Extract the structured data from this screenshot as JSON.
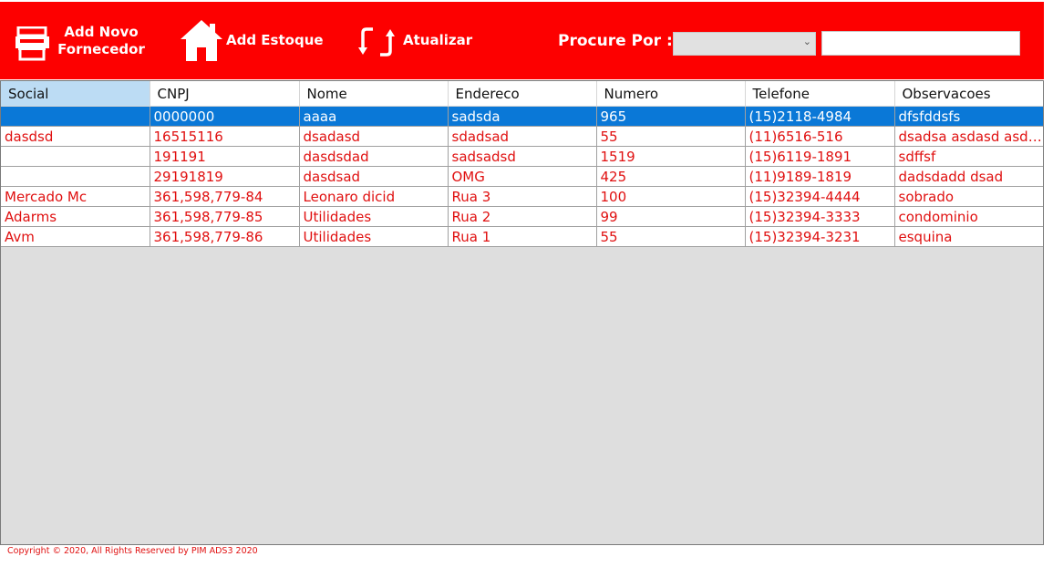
{
  "toolbar": {
    "add_fornecedor_line1": "Add Novo",
    "add_fornecedor_line2": "Fornecedor",
    "add_estoque_label": "Add Estoque",
    "atualizar_label": "Atualizar",
    "procure_label": "Procure Por :",
    "filter_select_value": "",
    "search_value": "",
    "icons": [
      "printer-icon",
      "home-icon",
      "refresh-icon"
    ]
  },
  "grid": {
    "columns": [
      "Social",
      "CNPJ",
      "Nome",
      "Endereco",
      "Numero",
      "Telefone",
      "Observacoes"
    ],
    "selected_row": 0,
    "rows": [
      [
        "",
        "0000000",
        "aaaa",
        "sadsda",
        "965",
        "(15)2118-4984",
        "dfsfddsfs"
      ],
      [
        "dasdsd",
        "16515116",
        "dsadasd",
        "sdadsad",
        "55",
        "(11)6516-516",
        "dsadsa asdasd asdasdasd"
      ],
      [
        "",
        "191191",
        "dasdsdad",
        "sadsadsd",
        "1519",
        "(15)6119-1891",
        "sdffsf"
      ],
      [
        "",
        "29191819",
        "dasdsad",
        "OMG",
        "425",
        "(11)9189-1819",
        "dadsdadd dsad"
      ],
      [
        "Mercado Mc",
        "361,598,779-84",
        "Leonaro dicid",
        "Rua 3",
        "100",
        "(15)32394-4444",
        "sobrado"
      ],
      [
        "Adarms",
        "361,598,779-85",
        "Utilidades",
        "Rua 2",
        "99",
        "(15)32394-3333",
        "condominio"
      ],
      [
        "Avm",
        "361,598,779-86",
        "Utilidades",
        "Rua 1",
        "55",
        "(15)32394-3231",
        "esquina"
      ]
    ]
  },
  "footer": {
    "copyright": "Copyright © 2020, All Rights Reserved by PIM ADS3 2020"
  },
  "colors": {
    "toolbar_bg": "#fd0000",
    "selected_row": "#0a78d7",
    "text_red": "#e01010"
  }
}
